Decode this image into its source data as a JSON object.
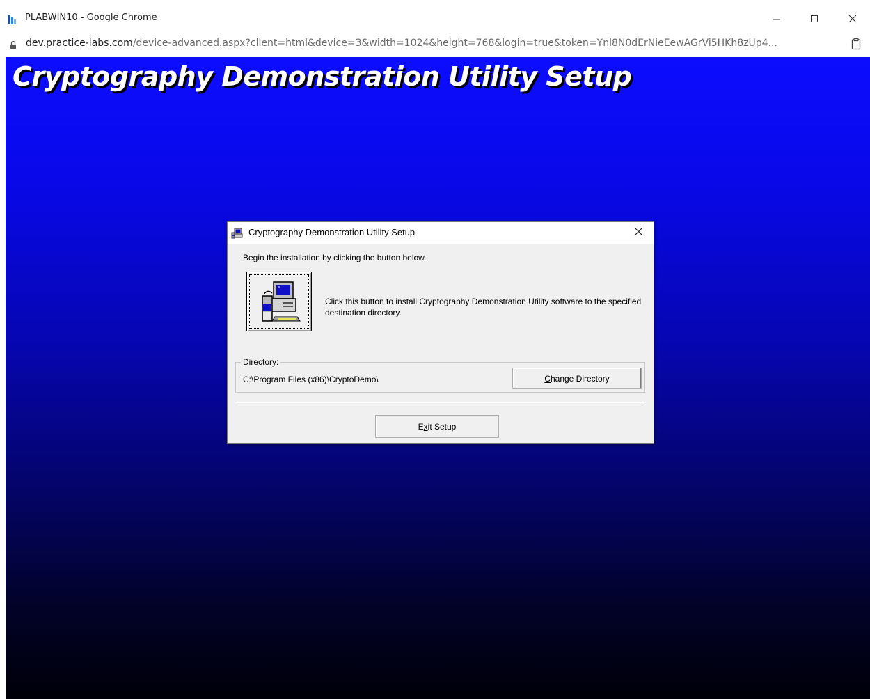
{
  "browser": {
    "window_title": "PLABWIN10 - Google Chrome",
    "url_host": "dev.practice-labs.com",
    "url_rest": "/device-advanced.aspx?client=html&device=3&width=1024&height=768&login=true&token=Ynl8N0dErNieEewAGrVi5HKh8zUp4...",
    "icons": {
      "app": "practice-labs-logo-icon",
      "minimize": "minimize-icon",
      "maximize": "maximize-icon",
      "close": "close-icon",
      "lock": "lock-icon",
      "clipboard": "clipboard-icon"
    }
  },
  "remote": {
    "banner_title": "Cryptography Demonstration Utility Setup",
    "background_colors": [
      "#0d0dff",
      "#000008"
    ]
  },
  "dialog": {
    "title": "Cryptography Demonstration Utility Setup",
    "intro": "Begin the installation by clicking the button below.",
    "install_description": "Click this button to install Cryptography Demonstration Utility software to the specified destination directory.",
    "directory_label": "Directory:",
    "directory_path": "C:\\Program Files (x86)\\CryptoDemo\\",
    "change_dir": {
      "accel": "C",
      "rest": "hange Directory"
    },
    "exit": {
      "pre": "E",
      "accel": "x",
      "post": "it Setup"
    },
    "icons": {
      "title": "setup-computer-icon",
      "install": "install-computer-icon",
      "close": "close-icon"
    }
  }
}
